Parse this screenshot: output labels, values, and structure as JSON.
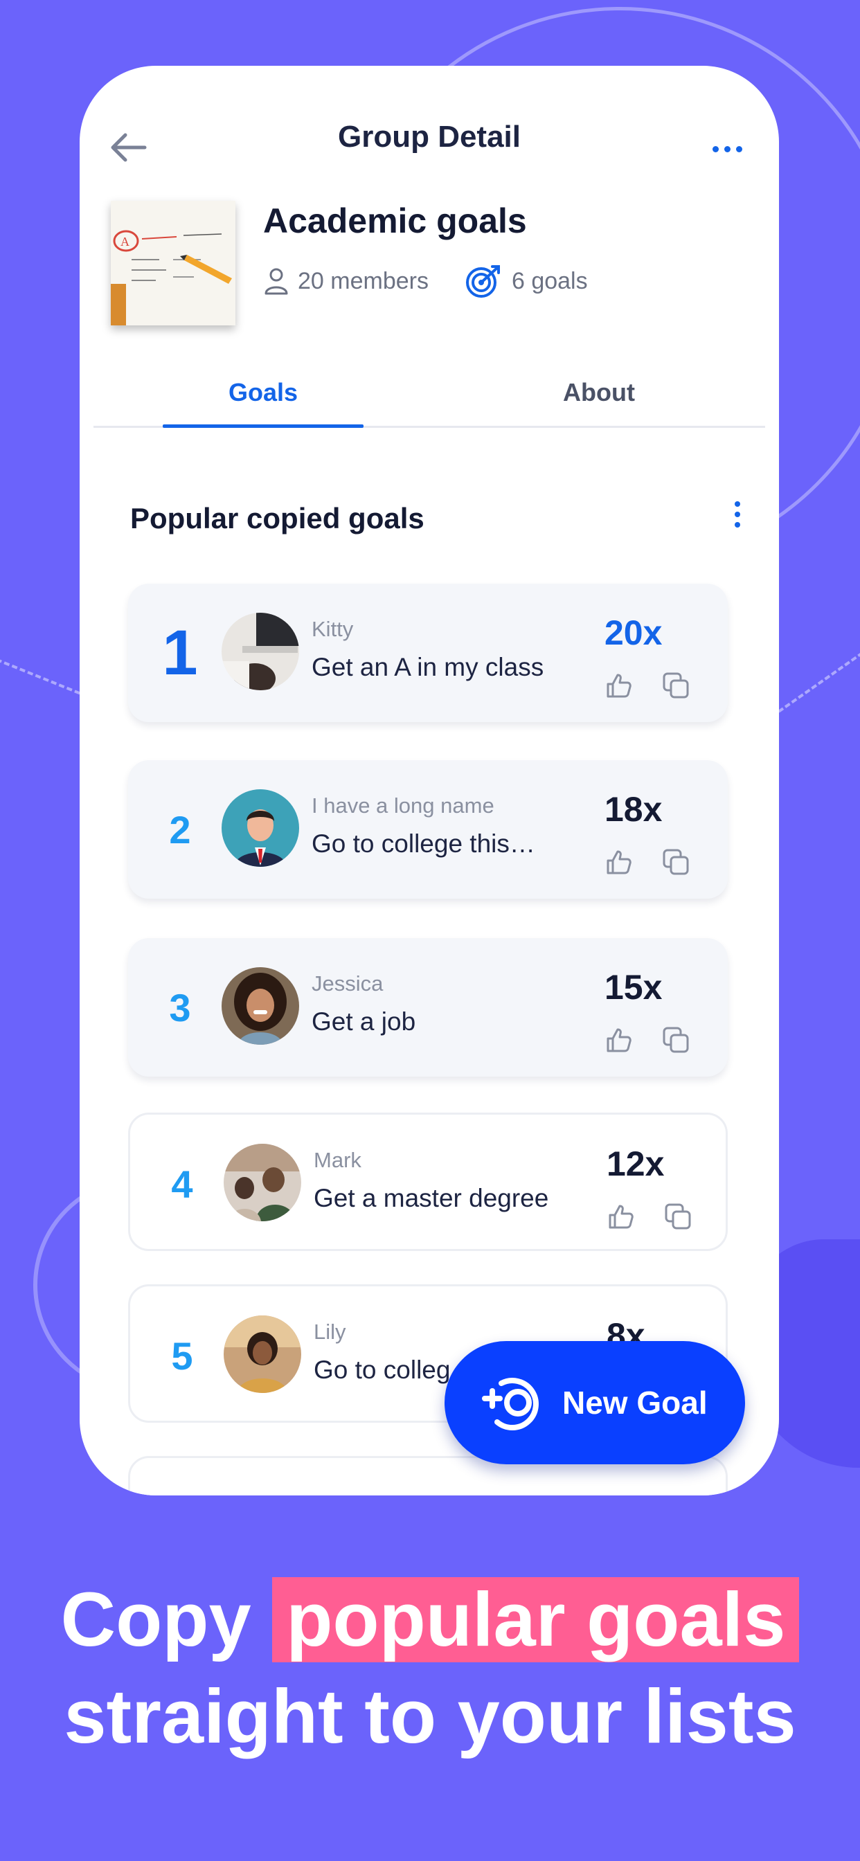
{
  "header": {
    "title": "Group Detail"
  },
  "group": {
    "name": "Academic goals",
    "members": "20 members",
    "goals": "6 goals"
  },
  "tabs": [
    {
      "label": "Goals"
    },
    {
      "label": "About"
    }
  ],
  "section": {
    "title": "Popular copied goals"
  },
  "goals": [
    {
      "rank": "1",
      "user": "Kitty",
      "goal": "Get an A in my class",
      "count": "20x"
    },
    {
      "rank": "2",
      "user": "I have a long name",
      "goal": "Go to college this…",
      "count": "18x"
    },
    {
      "rank": "3",
      "user": "Jessica",
      "goal": "Get a job",
      "count": "15x"
    },
    {
      "rank": "4",
      "user": "Mark",
      "goal": "Get a master degree",
      "count": "12x"
    },
    {
      "rank": "5",
      "user": "Lily",
      "goal": "Go to colleg",
      "count": "8x"
    }
  ],
  "fab": {
    "label": "New Goal"
  },
  "promo": {
    "prefix": "Copy ",
    "highlight": "popular goals",
    "line2": "straight to your lists"
  },
  "colors": {
    "background": "#6B63FB",
    "accent": "#1364E8",
    "fab": "#0A40FF",
    "highlight": "#FF5E93"
  }
}
